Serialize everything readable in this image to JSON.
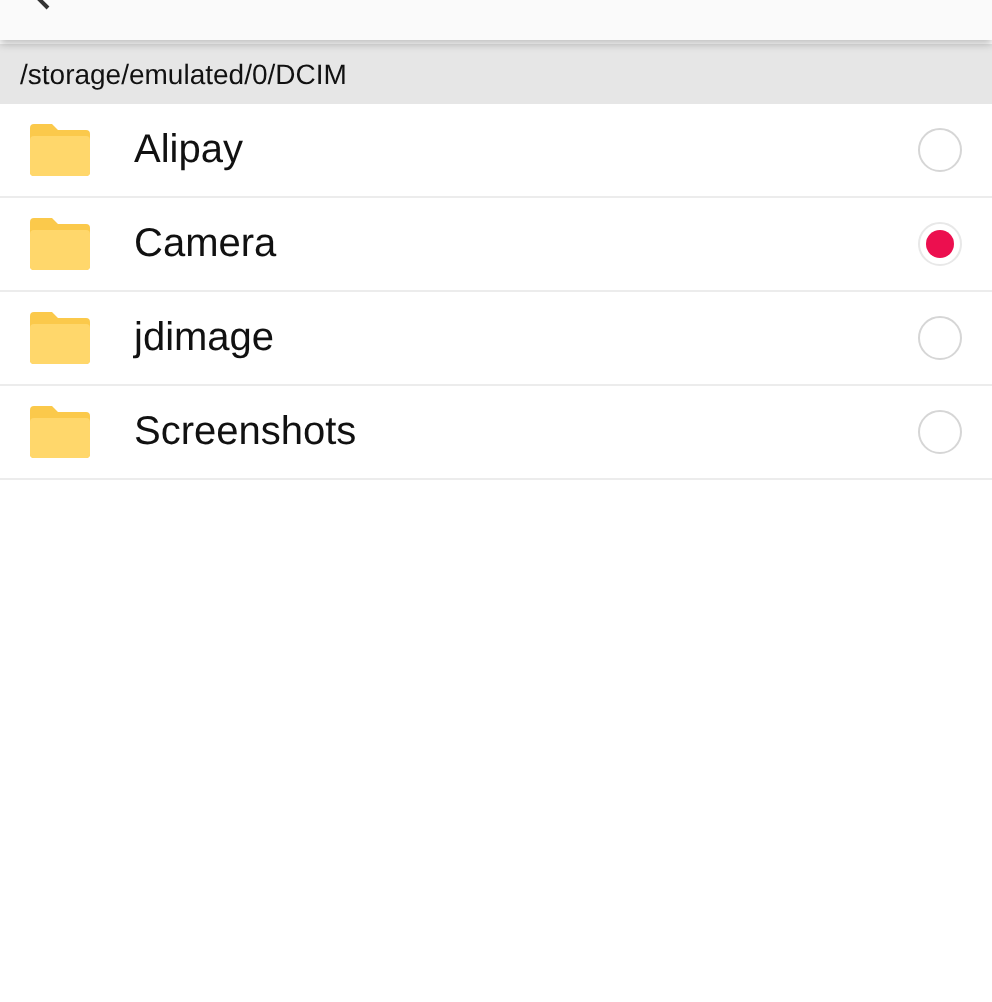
{
  "path": "/storage/emulated/0/DCIM",
  "folders": [
    {
      "name": "Alipay",
      "selected": false
    },
    {
      "name": "Camera",
      "selected": true
    },
    {
      "name": "jdimage",
      "selected": false
    },
    {
      "name": "Screenshots",
      "selected": false
    }
  ]
}
